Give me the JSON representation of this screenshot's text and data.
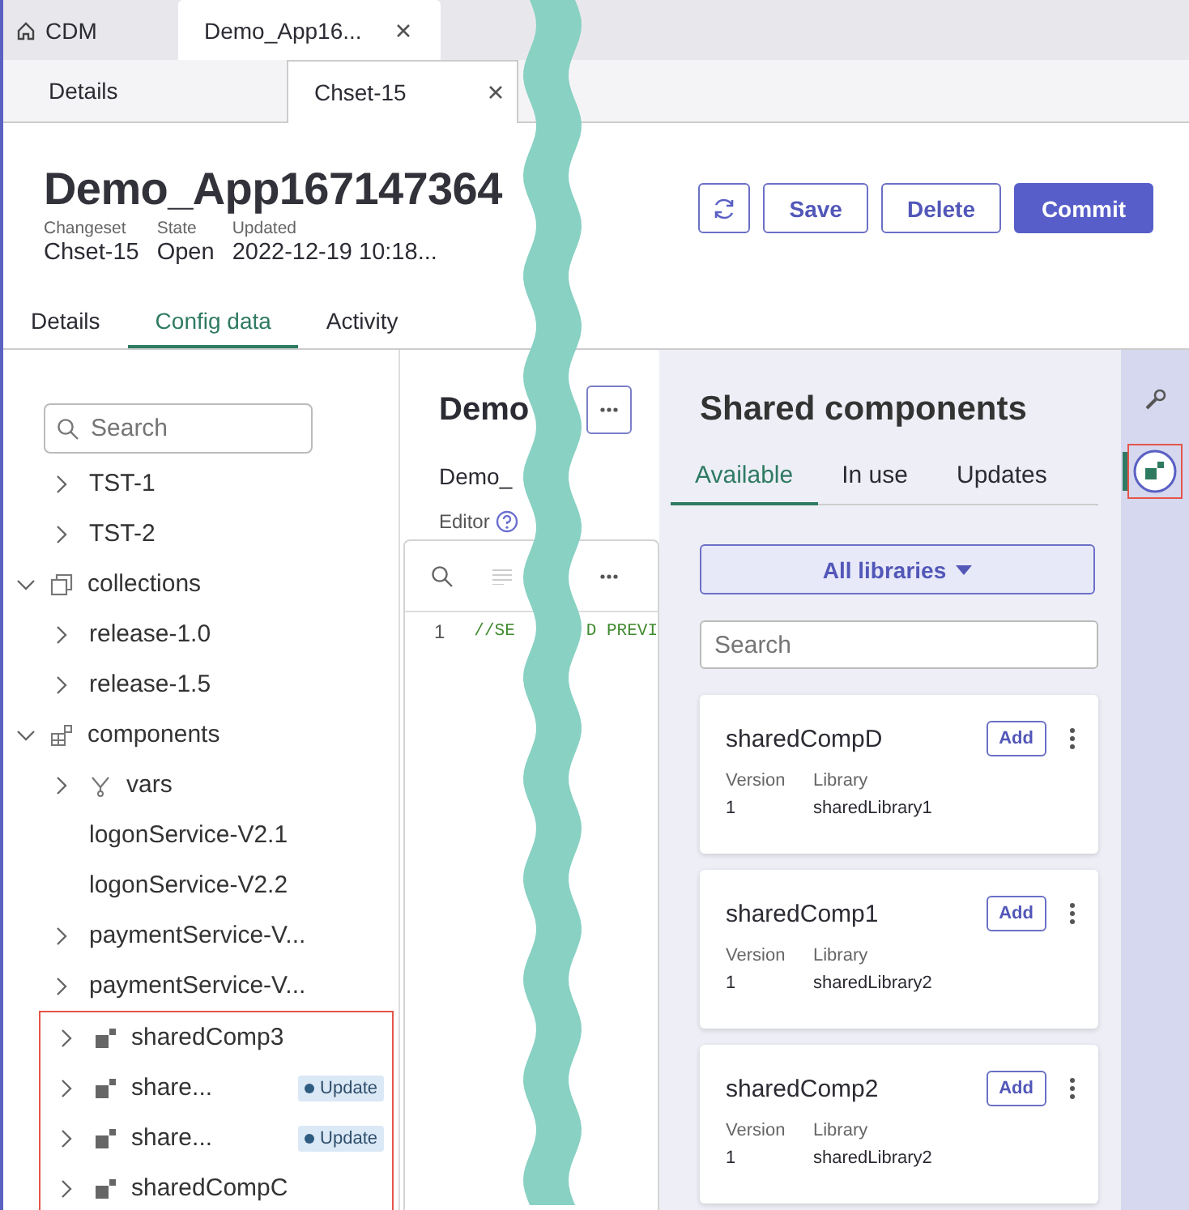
{
  "app_tabs": [
    {
      "label": "CDM",
      "kind": "home",
      "selected": false,
      "closable": false
    },
    {
      "label": "Demo_App16...",
      "kind": "document",
      "selected": true,
      "closable": true
    }
  ],
  "record_tabs": [
    {
      "label": "Details",
      "selected": false,
      "closable": false
    },
    {
      "label": "Chset-15",
      "selected": true,
      "closable": true
    }
  ],
  "header": {
    "title": "Demo_App167147364",
    "fields": [
      {
        "label": "Changeset",
        "value": "Chset-15"
      },
      {
        "label": "State",
        "value": "Open"
      },
      {
        "label": "Updated",
        "value": "2022-12-19 10:18..."
      }
    ],
    "buttons": [
      {
        "kind": "refresh"
      },
      {
        "kind": "outline",
        "label": "Save"
      },
      {
        "kind": "outline",
        "label": "Delete"
      },
      {
        "kind": "primary",
        "label": "Commit"
      }
    ]
  },
  "page_tabs": [
    {
      "label": "Details",
      "selected": false
    },
    {
      "label": "Config data",
      "selected": true
    },
    {
      "label": "Activity",
      "selected": false
    }
  ],
  "tree": {
    "search": {
      "placeholder": "Search"
    },
    "leading_items": [
      {
        "label": "TST-1",
        "kind": "item",
        "expanded": false,
        "highlighted": false
      },
      {
        "label": "TST-2",
        "kind": "item",
        "expanded": false,
        "highlighted": false
      }
    ],
    "items": [
      {
        "label": "collections",
        "kind": "collections",
        "expanded": true,
        "highlighted": false,
        "children": [
          {
            "label": "release-1.0",
            "kind": "item",
            "expanded": false,
            "highlighted": false
          },
          {
            "label": "release-1.5",
            "kind": "item",
            "expanded": false,
            "highlighted": false
          }
        ]
      },
      {
        "label": "components",
        "kind": "components",
        "expanded": true,
        "highlighted": false,
        "children": [
          {
            "label": "vars",
            "kind": "vars",
            "expanded": false,
            "highlighted": false
          },
          {
            "label": "logonService-V2.1",
            "kind": "leaf",
            "highlighted": false
          },
          {
            "label": "logonService-V2.2",
            "kind": "leaf",
            "highlighted": false
          },
          {
            "label": "paymentService-V...",
            "kind": "item",
            "expanded": false,
            "highlighted": false
          },
          {
            "label": "paymentService-V...",
            "kind": "item",
            "expanded": false,
            "highlighted": false
          },
          {
            "label": "sharedComp3",
            "kind": "shared",
            "expanded": false,
            "highlighted": true
          },
          {
            "label": "share...",
            "kind": "shared",
            "expanded": false,
            "highlighted": true,
            "badge": "Update"
          },
          {
            "label": "share...",
            "kind": "shared",
            "expanded": false,
            "highlighted": true,
            "badge": "Update"
          },
          {
            "label": "sharedCompC",
            "kind": "shared",
            "expanded": false,
            "highlighted": true
          }
        ]
      }
    ]
  },
  "editor": {
    "title": "Demo",
    "subtitle": "Demo_",
    "label": "Editor",
    "lines": [
      {
        "number": "1",
        "code_left": "//SE",
        "code_right": "D PREVI"
      }
    ]
  },
  "shared": {
    "title": "Shared components",
    "tabs": [
      {
        "label": "Available",
        "selected": true
      },
      {
        "label": "In use",
        "selected": false
      },
      {
        "label": "Updates",
        "selected": false
      }
    ],
    "filter": "All libraries",
    "search": {
      "placeholder": "Search"
    },
    "cards": [
      {
        "name": "sharedCompD",
        "action": "Add",
        "version_label": "Version",
        "version": "1",
        "library_label": "Library",
        "library": "sharedLibrary1"
      },
      {
        "name": "sharedComp1",
        "action": "Add",
        "version_label": "Version",
        "version": "1",
        "library_label": "Library",
        "library": "sharedLibrary2"
      },
      {
        "name": "sharedComp2",
        "action": "Add",
        "version_label": "Version",
        "version": "1",
        "library_label": "Library",
        "library": "sharedLibrary2"
      }
    ]
  },
  "rail": [
    {
      "kind": "tools",
      "selected": false,
      "highlighted": false
    },
    {
      "kind": "shared",
      "selected": true,
      "highlighted": true
    }
  ]
}
